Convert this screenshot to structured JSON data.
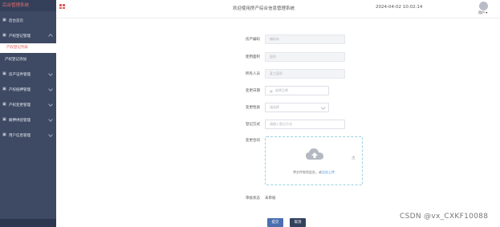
{
  "sidebar": {
    "brand": "后台管理系统",
    "home": "后台首页",
    "section1": "产权登记管理",
    "active_sub": "产权登记列表",
    "sub2": "产权登记添加",
    "items": [
      "房产证件管理",
      "产权抵押管理",
      "产权变更管理",
      "解押供验管理",
      "用户信息管理"
    ]
  },
  "header": {
    "title": "欢迎使用房产综合信息管理系统",
    "datetime": "2024-04-02 10:02:14",
    "user": "用户 ▾"
  },
  "form": {
    "fields": [
      {
        "label": "房产编码",
        "placeholder": "编码未"
      },
      {
        "label": "使用面积",
        "placeholder": "面积"
      },
      {
        "label": "所有人员",
        "placeholder": "某工面积"
      },
      {
        "label": "变更日期",
        "placeholder": "选择日期"
      },
      {
        "label": "变更性质",
        "placeholder": "请选择"
      },
      {
        "label": "登记方式",
        "placeholder": "请输入登记方式"
      }
    ],
    "upload_label": "变更合同",
    "upload_text": "将文件拖到此处，或",
    "upload_link": "点击上传",
    "status_label": "审核状态",
    "status_value": "未审核",
    "submit": "提交",
    "cancel": "取消"
  },
  "watermark": "CSDN @vx_CXKF10088"
}
